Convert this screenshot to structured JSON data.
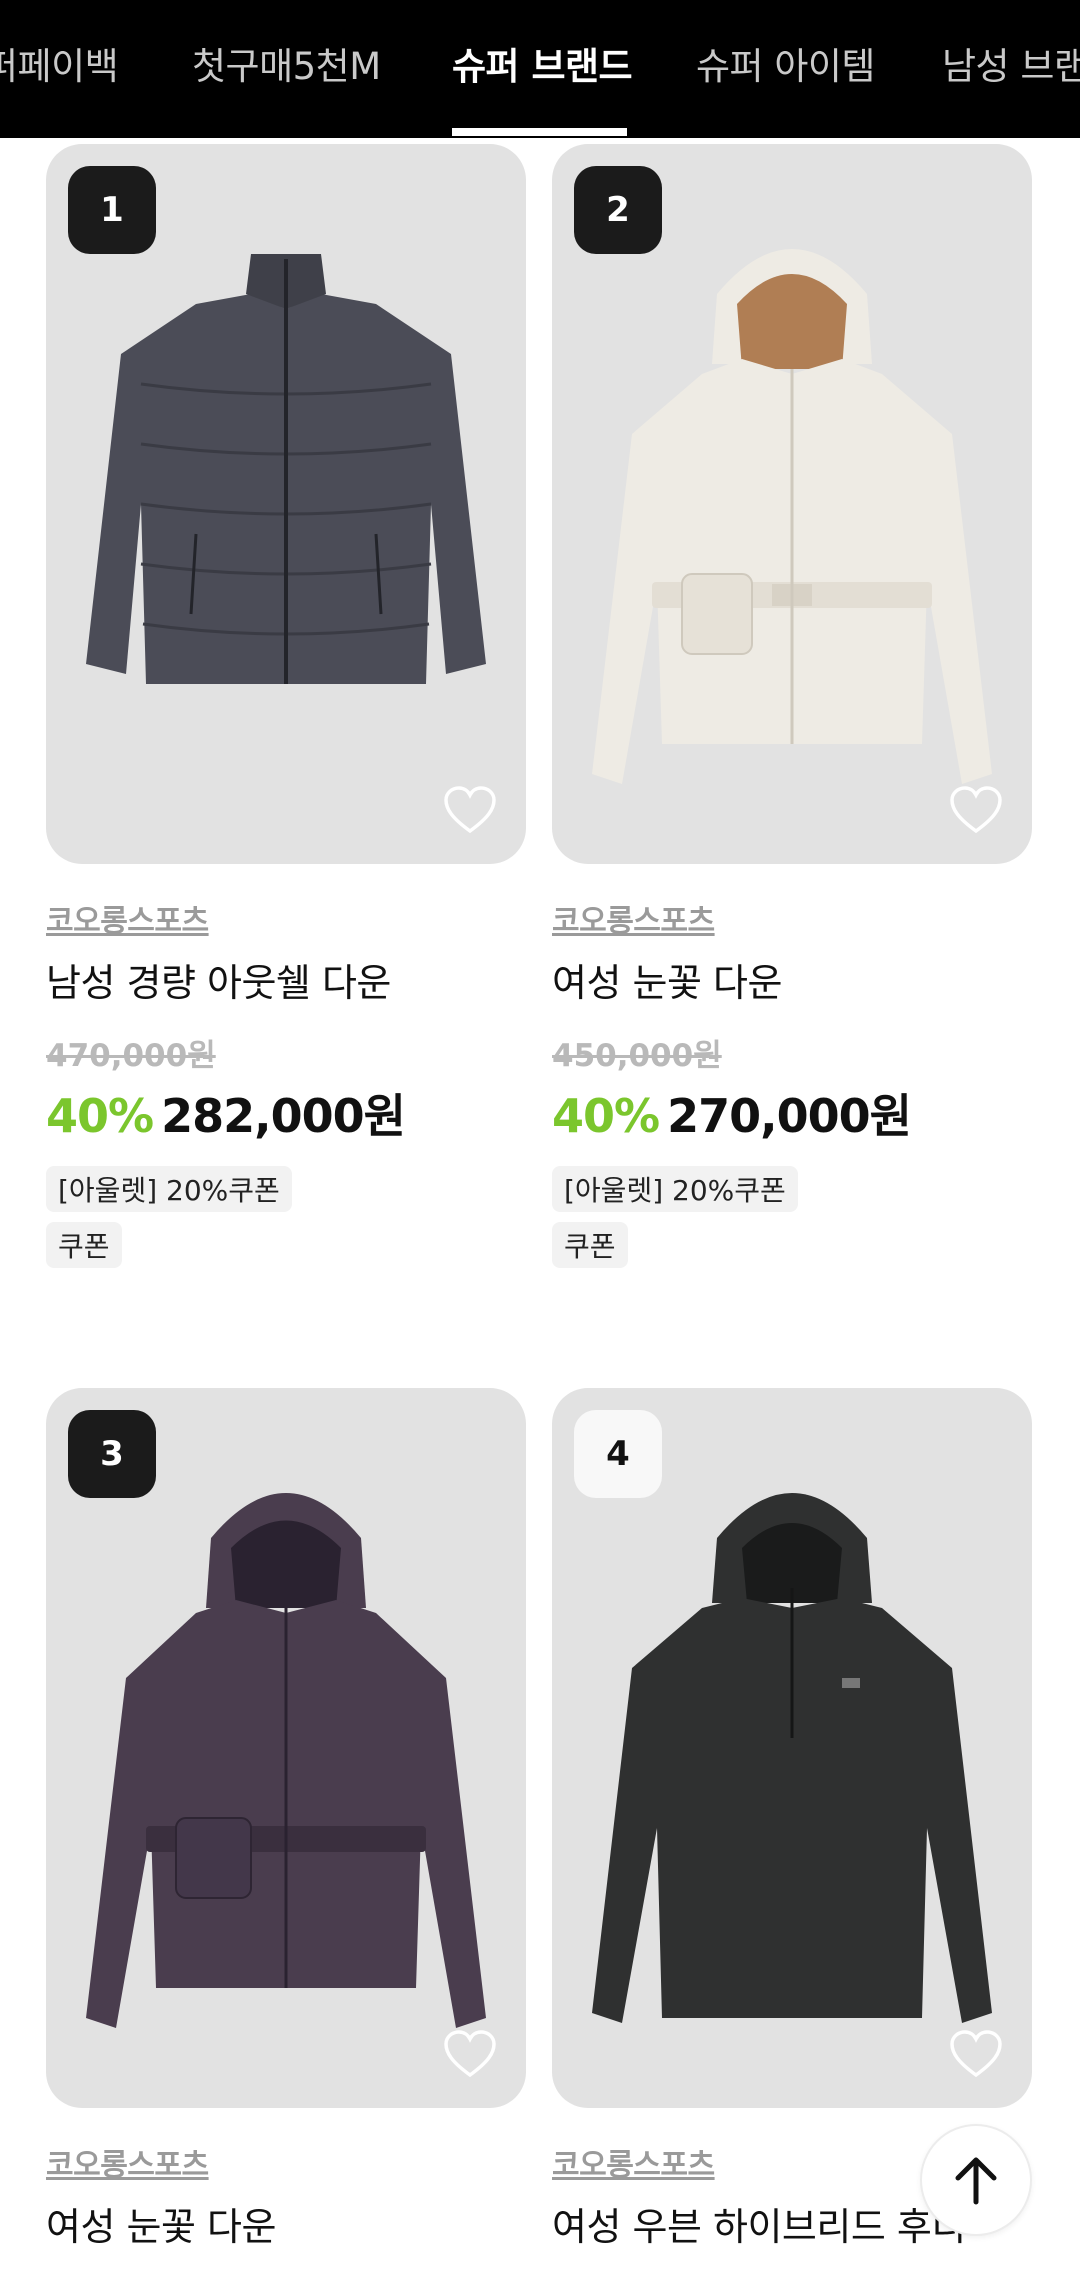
{
  "nav": {
    "tabs": [
      {
        "label": "퍼페이백"
      },
      {
        "label": "첫구매5천M"
      },
      {
        "label": "슈퍼 브랜드"
      },
      {
        "label": "슈퍼 아이템"
      },
      {
        "label": "남성 브랜"
      }
    ],
    "active_tab": "슈퍼 브랜드"
  },
  "products": [
    {
      "rank": "1",
      "brand": "코오롱스포츠",
      "name": "남성 경량 아웃쉘 다운",
      "original_price": "470,000원",
      "discount": "40%",
      "price": "282,000원",
      "tags": [
        "[아울렛] 20%쿠폰",
        "쿠폰"
      ],
      "jacket_color": "#4b4c57"
    },
    {
      "rank": "2",
      "brand": "코오롱스포츠",
      "name": "여성 눈꽃 다운",
      "original_price": "450,000원",
      "discount": "40%",
      "price": "270,000원",
      "tags": [
        "[아울렛] 20%쿠폰",
        "쿠폰"
      ],
      "jacket_color": "#eeebe4"
    },
    {
      "rank": "3",
      "brand": "코오롱스포츠",
      "name": "여성 눈꽃 다운",
      "jacket_color": "#4a3d4e"
    },
    {
      "rank": "4",
      "brand": "코오롱스포츠",
      "name": "여성 우븐 하이브리드 후디",
      "jacket_color": "#2f3030"
    }
  ],
  "colors": {
    "discount": "#7bc62d",
    "nav_bg": "#000000",
    "image_bg": "#e2e2e2"
  },
  "icons": [
    "heart-icon",
    "arrow-up-icon"
  ]
}
